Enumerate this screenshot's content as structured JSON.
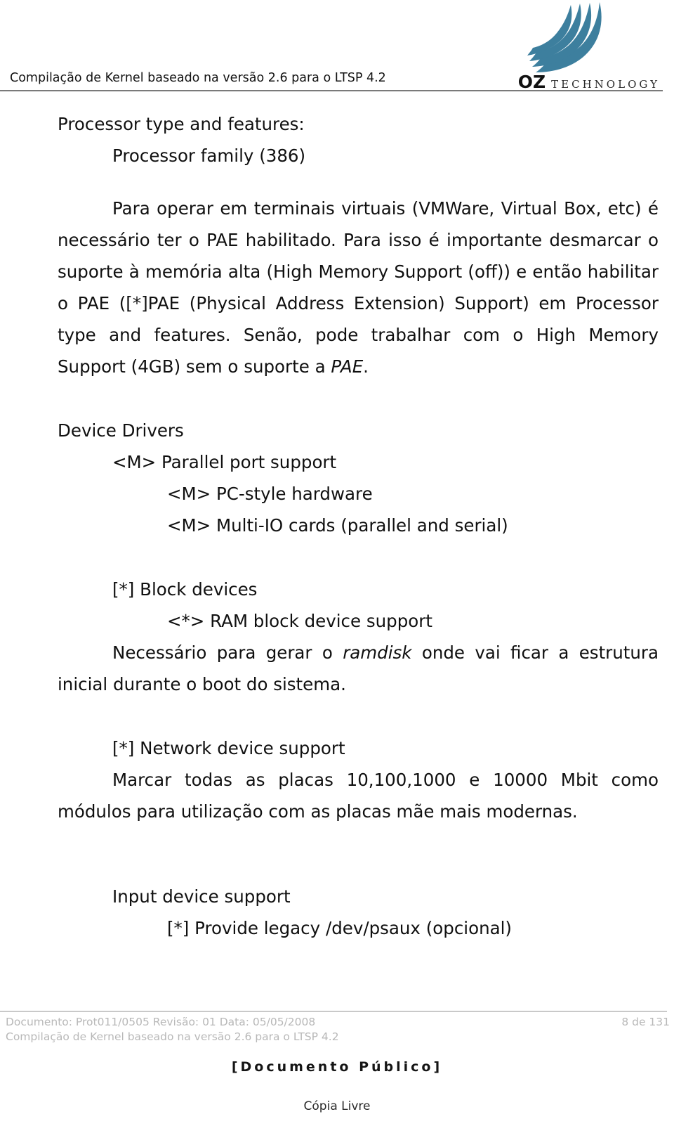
{
  "header": {
    "title": "Compilação de Kernel baseado na versão 2.6 para o LTSP 4.2",
    "logo": {
      "name": "OZ",
      "tagline": "TECHNOLOGY",
      "swoosh_color": "#3d7f9e",
      "icon": "oz-swoosh-logo"
    }
  },
  "content": {
    "section_processor": {
      "heading": "Processor type and features:",
      "item_family": "Processor family (386)",
      "paragraph": {
        "lead": "Para operar em terminais virtuais (VMWare, Virtual Box, etc) é necessário ter o PAE habilitado. Para isso é importante desmarcar o suporte à memória alta (High Memory Support (off)) e então habilitar o PAE ([*]PAE (Physical Address Extension) Support) em Processor type and features. Senão, pode trabalhar com o High Memory Support (4GB)  sem o suporte a ",
        "emphasis": "PAE",
        "tail": "."
      }
    },
    "section_device_drivers": {
      "heading": "Device Drivers",
      "item_parallel": "<M> Parallel port support",
      "item_pcstyle": "<M>   PC-style hardware",
      "item_multiio": "<M>     Multi-IO cards (parallel and serial)"
    },
    "section_block_devices": {
      "heading": "[*] Block devices",
      "item_ram": "<*>   RAM block device support",
      "paragraph": {
        "lead": "Necessário para gerar o ",
        "emphasis": "ramdisk",
        "tail": " onde vai ficar a estrutura inicial durante o boot do sistema."
      }
    },
    "section_network": {
      "heading": "[*] Network device support",
      "paragraph": "Marcar todas as placas 10,100,1000 e 10000 Mbit como módulos para utilização com as placas mãe mais modernas."
    },
    "section_input": {
      "heading": "Input device support",
      "item_psaux": "[*]     Provide legacy /dev/psaux (opcional)"
    }
  },
  "footer": {
    "meta_line1": "Documento: Prot011/0505 Revisão: 01 Data: 05/05/2008",
    "meta_line2": "Compilação de Kernel baseado na versão 2.6 para o LTSP 4.2",
    "page_indicator": "8 de 131",
    "public_notice": "[Documento Público]",
    "copy_notice": "Cópia Livre"
  }
}
